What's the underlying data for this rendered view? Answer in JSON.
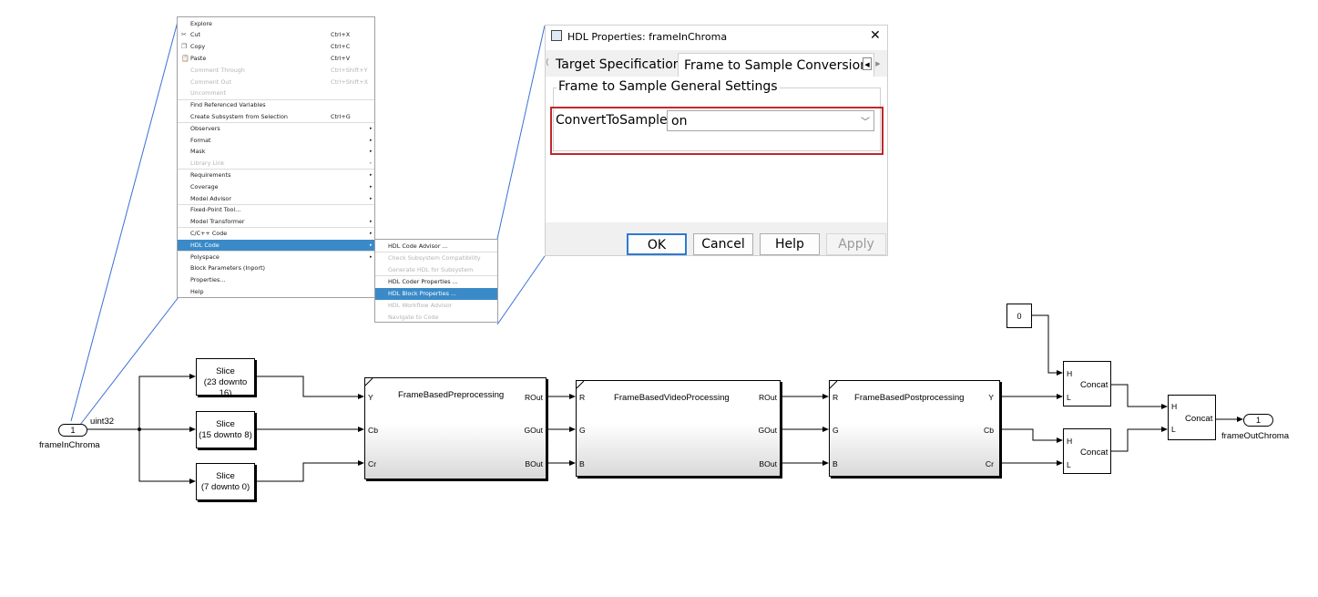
{
  "context_menu": {
    "items": [
      {
        "label": "Explore",
        "shortcut": "",
        "arrow": false,
        "disabled": false,
        "icon": ""
      },
      {
        "label": "Cut",
        "shortcut": "Ctrl+X",
        "arrow": false,
        "disabled": false,
        "icon": "scissors-icon"
      },
      {
        "label": "Copy",
        "shortcut": "Ctrl+C",
        "arrow": false,
        "disabled": false,
        "icon": "copy-icon"
      },
      {
        "label": "Paste",
        "shortcut": "Ctrl+V",
        "arrow": false,
        "disabled": false,
        "icon": "paste-icon"
      },
      {
        "label": "Comment Through",
        "shortcut": "Ctrl+Shift+Y",
        "arrow": false,
        "disabled": true,
        "icon": ""
      },
      {
        "label": "Comment Out",
        "shortcut": "Ctrl+Shift+X",
        "arrow": false,
        "disabled": true,
        "icon": ""
      },
      {
        "label": "Uncomment",
        "shortcut": "",
        "arrow": false,
        "disabled": true,
        "icon": ""
      },
      {
        "label": "Find Referenced Variables",
        "shortcut": "",
        "arrow": false,
        "disabled": false,
        "icon": ""
      },
      {
        "label": "Create Subsystem from Selection",
        "shortcut": "Ctrl+G",
        "arrow": false,
        "disabled": false,
        "icon": ""
      },
      {
        "label": "Observers",
        "shortcut": "",
        "arrow": true,
        "disabled": false,
        "icon": ""
      },
      {
        "label": "Format",
        "shortcut": "",
        "arrow": true,
        "disabled": false,
        "icon": ""
      },
      {
        "label": "Mask",
        "shortcut": "",
        "arrow": true,
        "disabled": false,
        "icon": ""
      },
      {
        "label": "Library Link",
        "shortcut": "",
        "arrow": true,
        "disabled": true,
        "icon": ""
      },
      {
        "label": "Requirements",
        "shortcut": "",
        "arrow": true,
        "disabled": false,
        "icon": ""
      },
      {
        "label": "Coverage",
        "shortcut": "",
        "arrow": true,
        "disabled": false,
        "icon": ""
      },
      {
        "label": "Model Advisor",
        "shortcut": "",
        "arrow": true,
        "disabled": false,
        "icon": ""
      },
      {
        "label": "Fixed-Point Tool...",
        "shortcut": "",
        "arrow": false,
        "disabled": false,
        "icon": ""
      },
      {
        "label": "Model Transformer",
        "shortcut": "",
        "arrow": true,
        "disabled": false,
        "icon": ""
      },
      {
        "label": "C/C++ Code",
        "shortcut": "",
        "arrow": true,
        "disabled": false,
        "icon": ""
      },
      {
        "label": "HDL Code",
        "shortcut": "",
        "arrow": true,
        "disabled": false,
        "icon": "",
        "highlighted": true
      },
      {
        "label": "Polyspace",
        "shortcut": "",
        "arrow": true,
        "disabled": false,
        "icon": ""
      },
      {
        "label": "Block Parameters (Inport)",
        "shortcut": "",
        "arrow": false,
        "disabled": false,
        "icon": ""
      },
      {
        "label": "Properties...",
        "shortcut": "",
        "arrow": false,
        "disabled": false,
        "icon": ""
      },
      {
        "label": "Help",
        "shortcut": "",
        "arrow": false,
        "disabled": false,
        "icon": ""
      }
    ]
  },
  "hdl_submenu": {
    "items": [
      {
        "label": "HDL Code Advisor ...",
        "disabled": false
      },
      {
        "label": "Check Subsystem Compatibility",
        "disabled": true
      },
      {
        "label": "Generate HDL for Subsystem",
        "disabled": true
      },
      {
        "label": "HDL Coder Properties ...",
        "disabled": false
      },
      {
        "label": "HDL Block Properties ...",
        "disabled": false,
        "highlighted": true
      },
      {
        "label": "HDL Workflow Advisor",
        "disabled": true
      },
      {
        "label": "Navigate to Code",
        "disabled": true
      }
    ]
  },
  "dialog": {
    "title": "HDL Properties: frameInChroma",
    "close_glyph": "✕",
    "tabs": [
      "Target Specification",
      "Frame to Sample Conversion"
    ],
    "group_label": "Frame to Sample General Settings",
    "param_label": "ConvertToSamples",
    "param_value": "on",
    "buttons": {
      "ok": "OK",
      "cancel": "Cancel",
      "help": "Help",
      "apply": "Apply"
    }
  },
  "model": {
    "inport": {
      "number": "1",
      "name": "frameInChroma",
      "signal_type": "uint32"
    },
    "slices": [
      "(23 downto 16)",
      "(15 downto 8)",
      "(7 downto 0)"
    ],
    "slice_title": "Slice",
    "pre": {
      "name": "FrameBasedPreprocessing",
      "inputs": [
        "Y",
        "Cb",
        "Cr"
      ],
      "outputs": [
        "ROut",
        "GOut",
        "BOut"
      ]
    },
    "video": {
      "name": "FrameBasedVideoProcessing",
      "inputs": [
        "R",
        "G",
        "B"
      ],
      "outputs": [
        "ROut",
        "GOut",
        "BOut"
      ]
    },
    "post": {
      "name": "FrameBasedPostprocessing",
      "inputs": [
        "R",
        "G",
        "B"
      ],
      "outputs": [
        "Y",
        "Cb",
        "Cr"
      ]
    },
    "constant": "0",
    "concat": {
      "name": "Concat",
      "in_hi": "H",
      "in_lo": "L"
    },
    "outport": {
      "number": "1",
      "name": "frameOutChroma"
    }
  },
  "colors": {
    "selection": "#3a8ac8",
    "highlight_border": "#c0282d",
    "default_button": "#2f7bd0"
  }
}
